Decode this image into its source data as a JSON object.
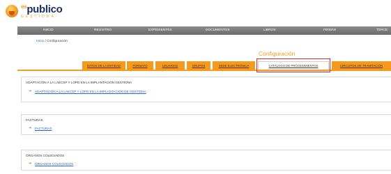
{
  "app": {
    "logo_main": "publico",
    "logo_prefix": "es",
    "logo_sub": "GESTIONA"
  },
  "nav": {
    "items": [
      "INICIO",
      "REGISTRO",
      "EXPEDIENTES",
      "DOCUMENTOS",
      "LIBROS",
      "FIRMAS",
      "TERCE"
    ]
  },
  "breadcrumb": {
    "home": "Inicio",
    "separator": " / ",
    "current": "Configuración"
  },
  "page": {
    "title": "Configuración"
  },
  "tabs": [
    {
      "label": "DATOS DE LA ENTIDAD",
      "active": false
    },
    {
      "label": "FORMATO",
      "active": false
    },
    {
      "label": "USUARIOS",
      "active": false
    },
    {
      "label": "GRUPOS",
      "active": false
    },
    {
      "label": "SEDE ELECTRÓNICA",
      "active": false
    },
    {
      "label": "CATÁLOGO DE PROCEDIMIENTOS",
      "active": true
    },
    {
      "label": "CIRCUITOS DE TRAMITACIÓN",
      "active": false
    }
  ],
  "sections": [
    {
      "title": "ADAPTACIÓN A LA LAECSP Y LOPD EN LA IMPLANTACIÓN GESTIONA",
      "link": "ADAPTACIÓN A LA LAECSP Y LOPD EN LA IMPLANTACIÓN DE GESTIONA"
    },
    {
      "title": "FACTURAS",
      "link": "FACTURAS"
    },
    {
      "title": "ÓRGANOS COLEGIADOS",
      "link": "ÓRGANOS COLEGIADOS"
    }
  ],
  "colors": {
    "accent": "#f39a1f",
    "nav_bg": "#7a7a7a",
    "link": "#2a66c4",
    "highlight": "#d62a2a",
    "bullet": "#4cae36"
  },
  "icons": {
    "logo": "publico-logo-icon",
    "bullet": "green-arrow-bullet-icon"
  }
}
